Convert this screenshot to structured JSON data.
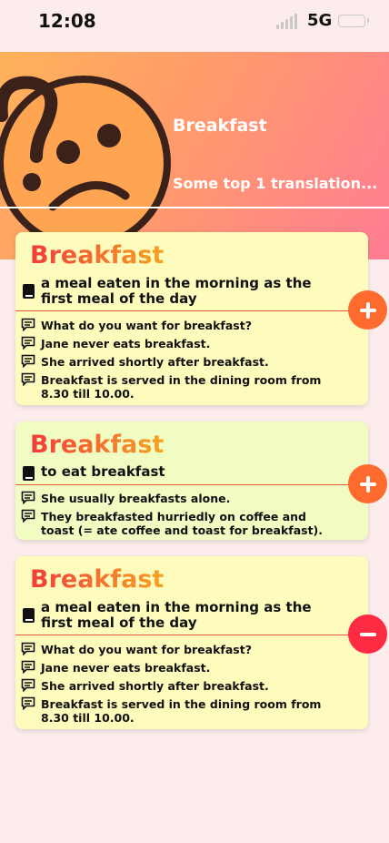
{
  "status_bar": {
    "time": "12:08",
    "network": "5G"
  },
  "hero": {
    "title": "Breakfast",
    "subtitle": "Some top 1 translation..."
  },
  "cards": [
    {
      "word": "Breakfast",
      "definition": "a meal eaten in the morning as the first meal of the day",
      "examples": [
        "What do you want for breakfast?",
        "Jane never eats breakfast.",
        "She arrived shortly after breakfast.",
        "Breakfast is served in the dining room from 8.30 till 10.00."
      ],
      "action": "add"
    },
    {
      "word": "Breakfast",
      "definition": "to eat breakfast",
      "examples": [
        "She usually breakfasts alone.",
        "They breakfasted hurriedly on coffee and toast (= ate coffee and toast for breakfast)."
      ],
      "action": "add"
    },
    {
      "word": "Breakfast",
      "definition": "a meal eaten in the morning as the first meal of the day",
      "examples": [
        "What do you want for breakfast?",
        "Jane never eats breakfast.",
        "She arrived shortly after breakfast.",
        "Breakfast is served in the dining room from 8.30 till 10.00."
      ],
      "action": "remove"
    }
  ],
  "colors": {
    "plus_button": "#ff6a2f",
    "minus_button": "#ff2b42",
    "card_yellow": "#fefcbc",
    "card_green": "#f1fcc3"
  }
}
